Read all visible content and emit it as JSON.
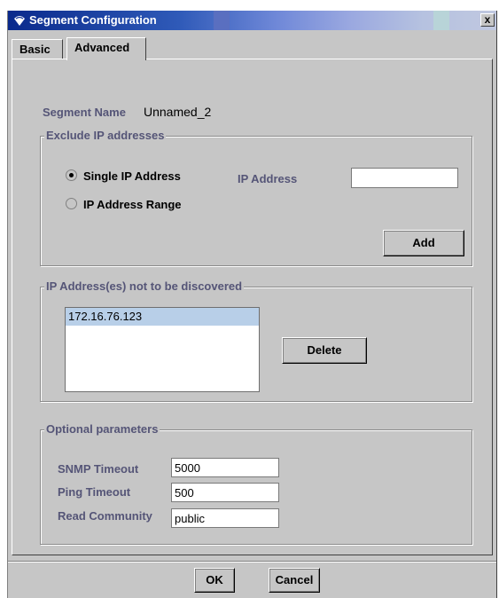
{
  "window": {
    "title": "Segment Configuration",
    "close_label": "x"
  },
  "tabs": [
    {
      "label": "Basic",
      "selected": false
    },
    {
      "label": "Advanced",
      "selected": true
    }
  ],
  "segment": {
    "name_label": "Segment Name",
    "name_value": "Unnamed_2"
  },
  "exclude": {
    "title": "Exclude IP addresses",
    "radio_single": "Single IP Address",
    "radio_range": "IP Address  Range",
    "selected_option": "Single IP Address",
    "ip_label": "IP Address",
    "ip_value": "",
    "add_label": "Add"
  },
  "not_discovered": {
    "title": "IP Address(es) not to be discovered",
    "items": [
      "172.16.76.123"
    ],
    "delete_label": "Delete"
  },
  "optional": {
    "title": "Optional parameters",
    "snmp_label": "SNMP Timeout",
    "snmp_value": "5000",
    "ping_label": "Ping Timeout",
    "ping_value": "500",
    "community_label": "Read Community",
    "community_value": "public"
  },
  "footer": {
    "ok_label": "OK",
    "cancel_label": "Cancel"
  }
}
